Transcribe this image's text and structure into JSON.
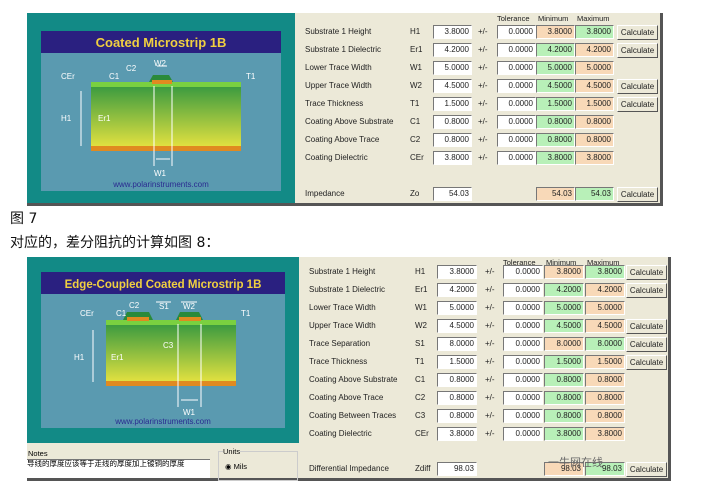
{
  "top": {
    "diagram": {
      "title": "Coated Microstrip 1B",
      "url": "www.polarinstruments.com",
      "labels": {
        "cer": "CEr",
        "c1": "C1",
        "c2": "C2",
        "w2": "W2",
        "t1": "T1",
        "h1": "H1",
        "er1": "Er1",
        "w1": "W1"
      }
    },
    "headers": {
      "tolerance": "Tolerance",
      "minimum": "Minimum",
      "maximum": "Maximum"
    },
    "rows": [
      {
        "label": "Substrate 1 Height",
        "symbol": "H1",
        "value": "3.8000",
        "pm": "+/-",
        "tol": "0.0000",
        "min": "3.8000",
        "max": "3.8000",
        "minc": "#f8d9b8",
        "maxc": "#b8f0b8",
        "calc": "Calculate"
      },
      {
        "label": "Substrate 1 Dielectric",
        "symbol": "Er1",
        "value": "4.2000",
        "pm": "+/-",
        "tol": "0.0000",
        "min": "4.2000",
        "max": "4.2000",
        "minc": "#b8f0b8",
        "maxc": "#f8d9b8",
        "calc": "Calculate"
      },
      {
        "label": "Lower Trace Width",
        "symbol": "W1",
        "value": "5.0000",
        "pm": "+/-",
        "tol": "0.0000",
        "min": "5.0000",
        "max": "5.0000",
        "minc": "#b8f0b8",
        "maxc": "#f8d9b8"
      },
      {
        "label": "Upper Trace Width",
        "symbol": "W2",
        "value": "4.5000",
        "pm": "+/-",
        "tol": "0.0000",
        "min": "4.5000",
        "max": "4.5000",
        "minc": "#b8f0b8",
        "maxc": "#f8d9b8",
        "calc": "Calculate"
      },
      {
        "label": "Trace Thickness",
        "symbol": "T1",
        "value": "1.5000",
        "pm": "+/-",
        "tol": "0.0000",
        "min": "1.5000",
        "max": "1.5000",
        "minc": "#b8f0b8",
        "maxc": "#f8d9b8",
        "calc": "Calculate"
      },
      {
        "label": "Coating Above Substrate",
        "symbol": "C1",
        "value": "0.8000",
        "pm": "+/-",
        "tol": "0.0000",
        "min": "0.8000",
        "max": "0.8000",
        "minc": "#b8f0b8",
        "maxc": "#f8d9b8"
      },
      {
        "label": "Coating Above Trace",
        "symbol": "C2",
        "value": "0.8000",
        "pm": "+/-",
        "tol": "0.0000",
        "min": "0.8000",
        "max": "0.8000",
        "minc": "#b8f0b8",
        "maxc": "#f8d9b8"
      },
      {
        "label": "Coating Dielectric",
        "symbol": "CEr",
        "value": "3.8000",
        "pm": "+/-",
        "tol": "0.0000",
        "min": "3.8000",
        "max": "3.8000",
        "minc": "#b8f0b8",
        "maxc": "#f8d9b8"
      }
    ],
    "result": {
      "label": "Impedance",
      "symbol": "Zo",
      "value": "54.03",
      "min": "54.03",
      "max": "54.03",
      "minc": "#f8d9b8",
      "maxc": "#b8f0b8",
      "calc": "Calculate"
    }
  },
  "caption1": "图 7",
  "caption2": "对应的，差分阻抗的计算如图 8：",
  "bottom": {
    "diagram": {
      "title": "Edge-Coupled Coated Microstrip 1B",
      "url": "www.polarinstruments.com",
      "labels": {
        "cer": "CEr",
        "c1": "C1",
        "c2": "C2",
        "s1": "S1",
        "w2": "W2",
        "t1": "T1",
        "c3": "C3",
        "h1": "H1",
        "er1": "Er1",
        "w1": "W1"
      }
    },
    "headers": {
      "tolerance": "Tolerance",
      "minimum": "Minimum",
      "maximum": "Maximum"
    },
    "rows": [
      {
        "label": "Substrate 1 Height",
        "symbol": "H1",
        "value": "3.8000",
        "pm": "+/-",
        "tol": "0.0000",
        "min": "3.8000",
        "max": "3.8000",
        "minc": "#f8d9b8",
        "maxc": "#b8f0b8",
        "calc": "Calculate"
      },
      {
        "label": "Substrate 1 Dielectric",
        "symbol": "Er1",
        "value": "4.2000",
        "pm": "+/-",
        "tol": "0.0000",
        "min": "4.2000",
        "max": "4.2000",
        "minc": "#b8f0b8",
        "maxc": "#f8d9b8",
        "calc": "Calculate"
      },
      {
        "label": "Lower Trace Width",
        "symbol": "W1",
        "value": "5.0000",
        "pm": "+/-",
        "tol": "0.0000",
        "min": "5.0000",
        "max": "5.0000",
        "minc": "#b8f0b8",
        "maxc": "#f8d9b8"
      },
      {
        "label": "Upper Trace Width",
        "symbol": "W2",
        "value": "4.5000",
        "pm": "+/-",
        "tol": "0.0000",
        "min": "4.5000",
        "max": "4.5000",
        "minc": "#b8f0b8",
        "maxc": "#f8d9b8",
        "calc": "Calculate"
      },
      {
        "label": "Trace Separation",
        "symbol": "S1",
        "value": "8.0000",
        "pm": "+/-",
        "tol": "0.0000",
        "min": "8.0000",
        "max": "8.0000",
        "minc": "#f8d9b8",
        "maxc": "#b8f0b8",
        "calc": "Calculate"
      },
      {
        "label": "Trace Thickness",
        "symbol": "T1",
        "value": "1.5000",
        "pm": "+/-",
        "tol": "0.0000",
        "min": "1.5000",
        "max": "1.5000",
        "minc": "#b8f0b8",
        "maxc": "#f8d9b8",
        "calc": "Calculate"
      },
      {
        "label": "Coating Above Substrate",
        "symbol": "C1",
        "value": "0.8000",
        "pm": "+/-",
        "tol": "0.0000",
        "min": "0.8000",
        "max": "0.8000",
        "minc": "#b8f0b8",
        "maxc": "#f8d9b8"
      },
      {
        "label": "Coating Above Trace",
        "symbol": "C2",
        "value": "0.8000",
        "pm": "+/-",
        "tol": "0.0000",
        "min": "0.8000",
        "max": "0.8000",
        "minc": "#b8f0b8",
        "maxc": "#f8d9b8"
      },
      {
        "label": "Coating Between Traces",
        "symbol": "C3",
        "value": "0.8000",
        "pm": "+/-",
        "tol": "0.0000",
        "min": "0.8000",
        "max": "0.8000",
        "minc": "#b8f0b8",
        "maxc": "#f8d9b8"
      },
      {
        "label": "Coating Dielectric",
        "symbol": "CEr",
        "value": "3.8000",
        "pm": "+/-",
        "tol": "0.0000",
        "min": "3.8000",
        "max": "3.8000",
        "minc": "#b8f0b8",
        "maxc": "#f8d9b8"
      }
    ],
    "result": {
      "label": "Differential Impedance",
      "symbol": "Zdiff",
      "value": "98.03",
      "min": "98.03",
      "max": "98.03",
      "minc": "#f8d9b8",
      "maxc": "#b8f0b8",
      "calc": "Calculate"
    },
    "notes": {
      "label": "Notes",
      "text": "导线的厚度应该等于走线的厚度加上镀铜的厚度"
    },
    "units": {
      "label": "Units",
      "selected": "Mils"
    },
    "watermark": "一牛网在线"
  }
}
